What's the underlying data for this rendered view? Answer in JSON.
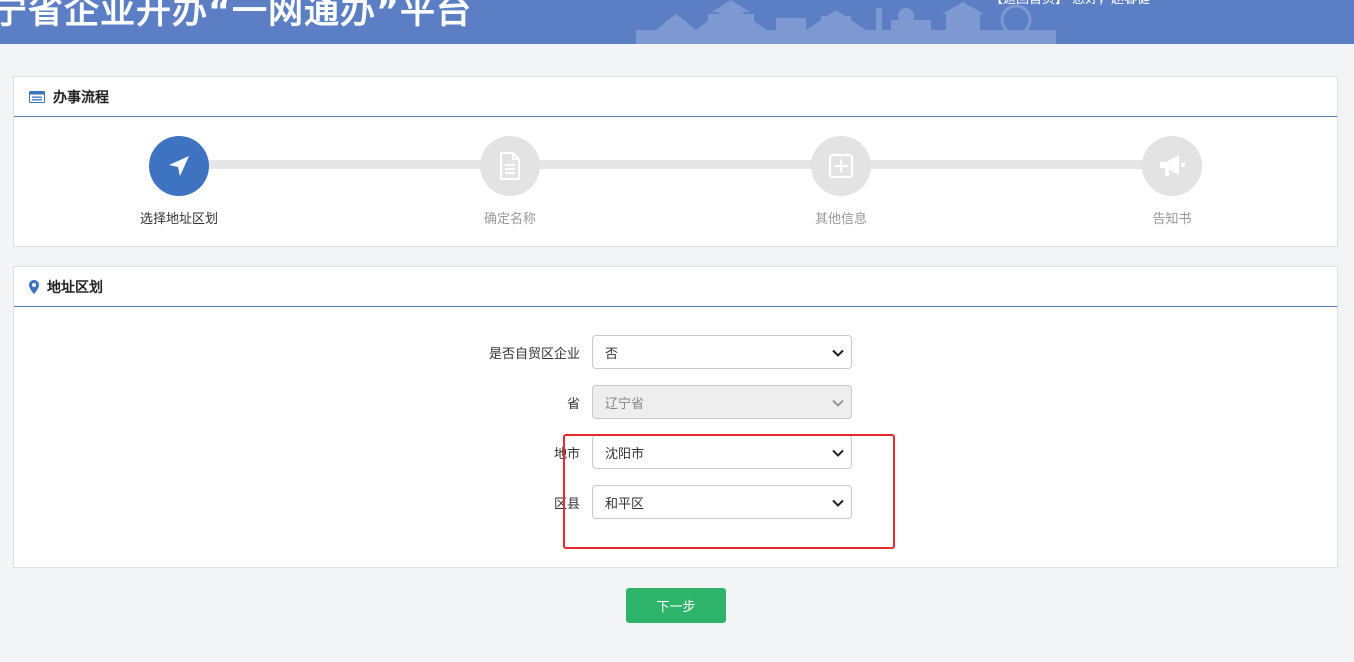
{
  "header": {
    "title": "宁省企业开办“一网通办”平台",
    "user_text": "【返回首页】 您好，赵春健"
  },
  "process_panel": {
    "title": "办事流程",
    "icon": "list-card-icon",
    "steps": [
      {
        "label": "选择地址区划",
        "icon": "location-arrow-icon",
        "active": true
      },
      {
        "label": "确定名称",
        "icon": "document-icon",
        "active": false
      },
      {
        "label": "其他信息",
        "icon": "plus-square-icon",
        "active": false
      },
      {
        "label": "告知书",
        "icon": "megaphone-icon",
        "active": false
      }
    ]
  },
  "address_panel": {
    "title": "地址区划",
    "icon": "map-pin-icon",
    "fields": [
      {
        "label": "是否自贸区企业",
        "value": "否",
        "disabled": false
      },
      {
        "label": "省",
        "value": "辽宁省",
        "disabled": true
      },
      {
        "label": "地市",
        "value": "沈阳市",
        "disabled": false
      },
      {
        "label": "区县",
        "value": "和平区",
        "disabled": false
      }
    ]
  },
  "actions": {
    "next_label": "下一步"
  },
  "colors": {
    "header_bg": "#5b7ec4",
    "step_active": "#3d73c1",
    "button_green": "#2db36a",
    "highlight_red": "#e52b2b"
  }
}
